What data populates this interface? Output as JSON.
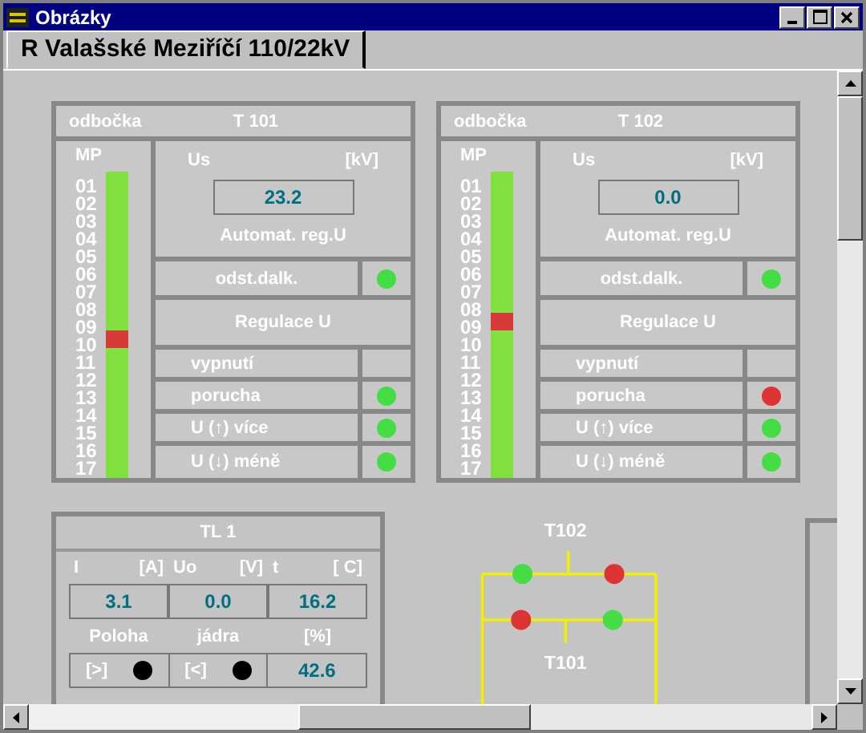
{
  "window": {
    "title": "Obrázky"
  },
  "tabs": [
    {
      "label": "R Valašské Meziříčí 110/22kV",
      "selected": true
    }
  ],
  "transformers": [
    {
      "header_left": "odbočka",
      "name": "T 101",
      "mp_label": "MP",
      "us_label": "Us",
      "us_unit": "[kV]",
      "us_value": "23.2",
      "auto_label": "Automat. reg.U",
      "remote": {
        "label": "odst.dalk.",
        "color": "#44dd44"
      },
      "regulation": "Regulace U",
      "positions": [
        {
          "label": "01",
          "selected": false
        },
        {
          "label": "02",
          "selected": false
        },
        {
          "label": "03",
          "selected": false
        },
        {
          "label": "04",
          "selected": false
        },
        {
          "label": "05",
          "selected": false
        },
        {
          "label": "06",
          "selected": false
        },
        {
          "label": "07",
          "selected": false
        },
        {
          "label": "08",
          "selected": false
        },
        {
          "label": "09",
          "selected": false
        },
        {
          "label": "10",
          "selected": true
        },
        {
          "label": "11",
          "selected": false
        },
        {
          "label": "12",
          "selected": false
        },
        {
          "label": "13",
          "selected": false
        },
        {
          "label": "14",
          "selected": false
        },
        {
          "label": "15",
          "selected": false
        },
        {
          "label": "16",
          "selected": false
        },
        {
          "label": "17",
          "selected": false
        }
      ],
      "signals": [
        {
          "label": "vypnutí"
        },
        {
          "label": "porucha",
          "color": "#44dd44"
        },
        {
          "label": "U (↑) více",
          "color": "#44dd44"
        },
        {
          "label": "U (↓) méně",
          "color": "#44dd44"
        }
      ]
    },
    {
      "header_left": "odbočka",
      "name": "T 102",
      "mp_label": "MP",
      "us_label": "Us",
      "us_unit": "[kV]",
      "us_value": "0.0",
      "auto_label": "Automat. reg.U",
      "remote": {
        "label": "odst.dalk.",
        "color": "#44dd44"
      },
      "regulation": "Regulace U",
      "positions": [
        {
          "label": "01",
          "selected": false
        },
        {
          "label": "02",
          "selected": false
        },
        {
          "label": "03",
          "selected": false
        },
        {
          "label": "04",
          "selected": false
        },
        {
          "label": "05",
          "selected": false
        },
        {
          "label": "06",
          "selected": false
        },
        {
          "label": "07",
          "selected": false
        },
        {
          "label": "08",
          "selected": false
        },
        {
          "label": "09",
          "selected": true
        },
        {
          "label": "10",
          "selected": false
        },
        {
          "label": "11",
          "selected": false
        },
        {
          "label": "12",
          "selected": false
        },
        {
          "label": "13",
          "selected": false
        },
        {
          "label": "14",
          "selected": false
        },
        {
          "label": "15",
          "selected": false
        },
        {
          "label": "16",
          "selected": false
        },
        {
          "label": "17",
          "selected": false
        }
      ],
      "signals": [
        {
          "label": "vypnutí"
        },
        {
          "label": "porucha",
          "color": "#dd3333"
        },
        {
          "label": "U (↑) více",
          "color": "#44dd44"
        },
        {
          "label": "U (↓) méně",
          "color": "#44dd44"
        }
      ]
    }
  ],
  "tl": {
    "title": "TL 1",
    "measures": [
      {
        "label": "I",
        "unit": "[A]",
        "value": "3.1"
      },
      {
        "label": "Uo",
        "unit": "[V]",
        "value": "0.0"
      },
      {
        "label": "t",
        "unit": "[ C]",
        "value": "16.2"
      }
    ],
    "labels": [
      "Poloha",
      "jádra",
      "[%]"
    ],
    "buttons": [
      {
        "label": "[>]",
        "color": "#000000"
      },
      {
        "label": "[<]",
        "color": "#000000"
      }
    ],
    "percent": "42.6"
  },
  "diagram": {
    "top_label": "T102",
    "bottom_label": "T101",
    "switches": [
      {
        "color": "#44dd44"
      },
      {
        "color": "#dd3333"
      },
      {
        "color": "#dd3333"
      },
      {
        "color": "#44dd44"
      }
    ]
  }
}
